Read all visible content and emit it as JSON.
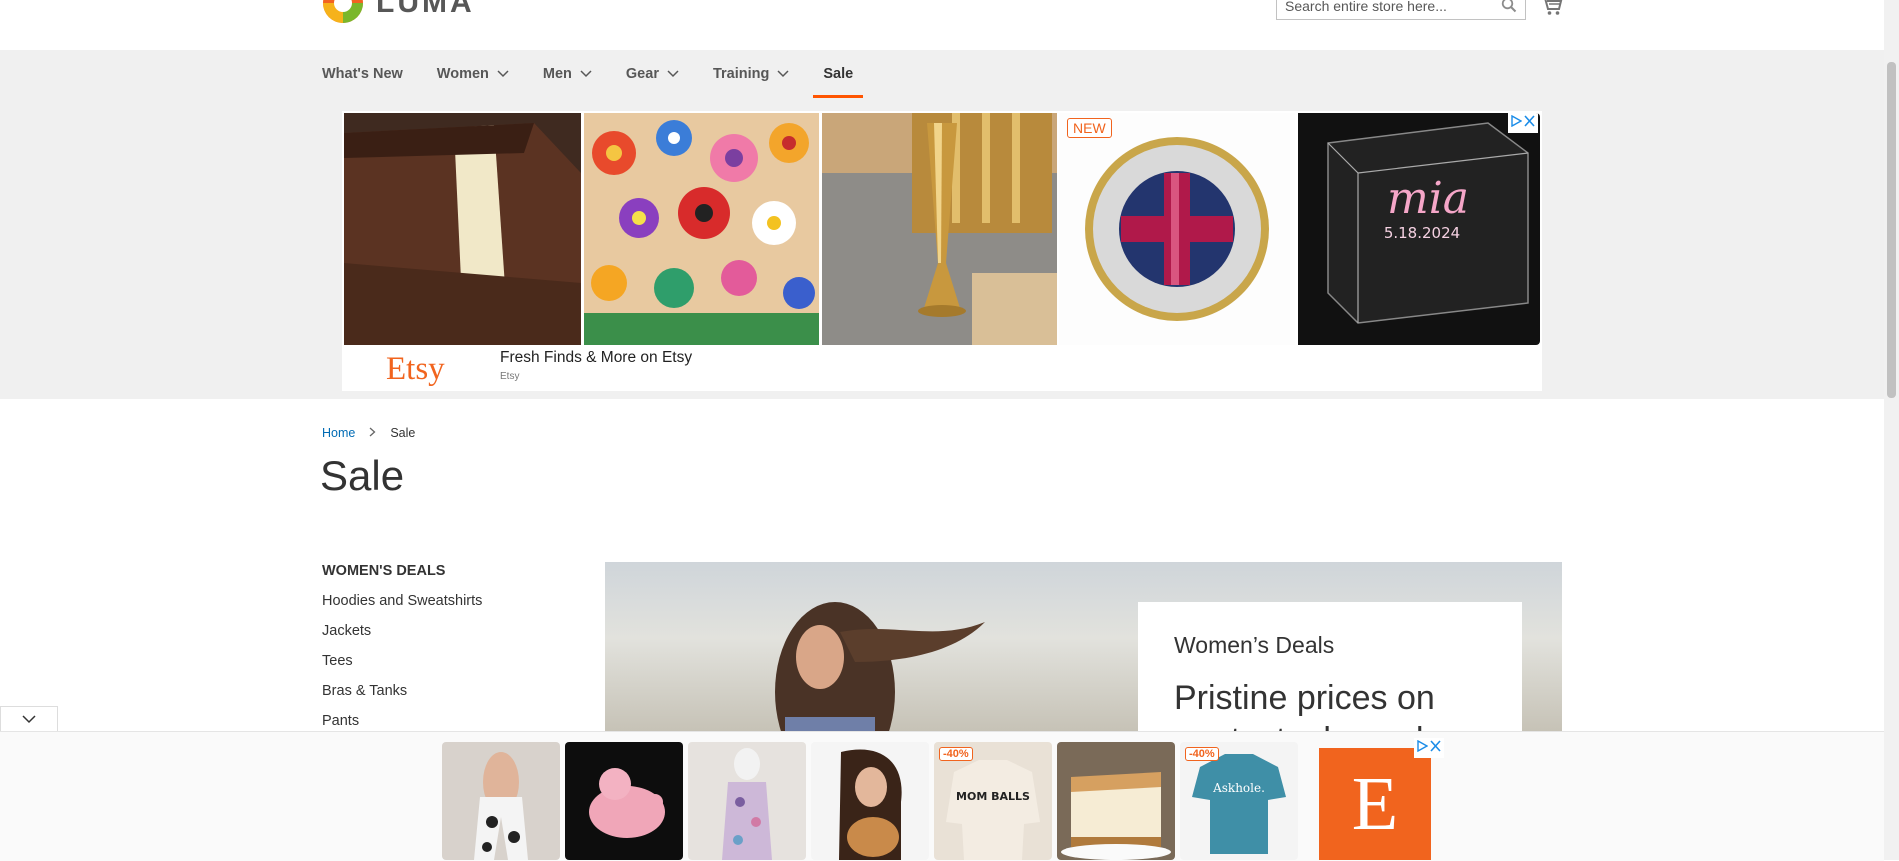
{
  "header": {
    "logo_text": "LUMA",
    "search": {
      "placeholder": "Search entire store here...",
      "value": ""
    },
    "icons": [
      "search-icon",
      "cart-icon"
    ]
  },
  "nav": {
    "items": [
      {
        "label": "What's New",
        "has_dropdown": false
      },
      {
        "label": "Women",
        "has_dropdown": true
      },
      {
        "label": "Men",
        "has_dropdown": true
      },
      {
        "label": "Gear",
        "has_dropdown": true
      },
      {
        "label": "Training",
        "has_dropdown": true
      },
      {
        "label": "Sale",
        "has_dropdown": false,
        "active": true
      }
    ],
    "active_color": "#ff5501"
  },
  "top_ad": {
    "badge": "NEW",
    "tile_text": {
      "name": "mia",
      "date": "5.18.2024"
    },
    "brand": "Etsy",
    "title": "Fresh Finds & More on Etsy",
    "source": "Etsy",
    "brand_color": "#f1641e"
  },
  "breadcrumb": {
    "home": "Home",
    "current": "Sale"
  },
  "page_title": "Sale",
  "sidebar": {
    "heading": "WOMEN'S DEALS",
    "links": [
      "Hoodies and Sweatshirts",
      "Jackets",
      "Tees",
      "Bras & Tanks",
      "Pants"
    ]
  },
  "hero": {
    "subtitle": "Women’s Deals",
    "headline": "Pristine prices on",
    "headline_cut": "pants, tanks and"
  },
  "bottom_ad": {
    "discount_1": "-40%",
    "discount_2": "-40%",
    "tee_text": "Askhole.",
    "sweat_text": "MOM BALLS",
    "etsy_letter": "E"
  }
}
